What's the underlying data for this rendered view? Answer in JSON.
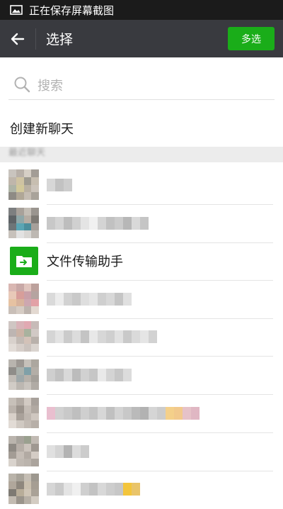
{
  "status_bar": {
    "text": "正在保存屏幕截图",
    "icon": "image-icon"
  },
  "toolbar": {
    "title": "选择",
    "multi_select_label": "多选",
    "back_icon": "arrow-left-icon"
  },
  "search": {
    "placeholder": "搜索"
  },
  "new_chat_label": "创建新聊天",
  "section_header": "最近聊天",
  "helper": {
    "name": "文件传输助手",
    "icon": "folder-arrow-icon"
  },
  "colors": {
    "toolbar": "#393a3f",
    "accent": "#1aad19",
    "status_bar": "#1b1b1b"
  }
}
